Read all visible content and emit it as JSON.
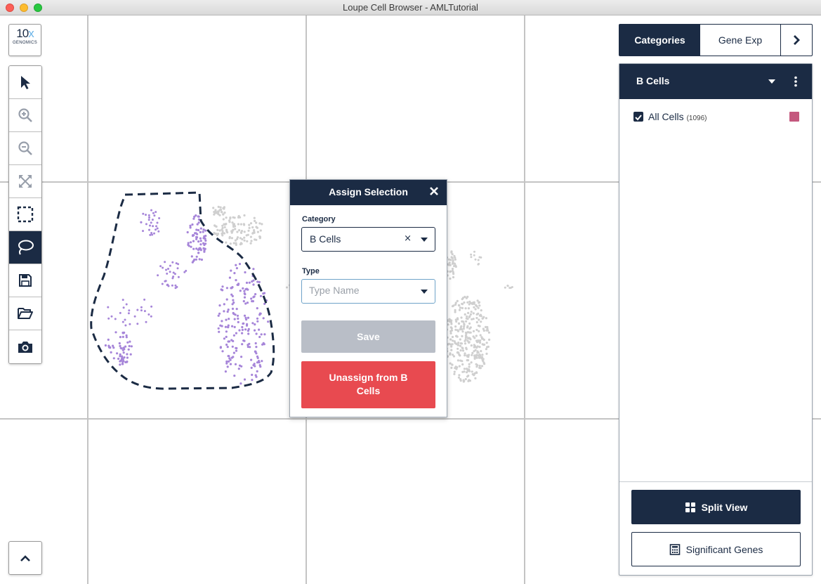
{
  "window": {
    "title": "Loupe Cell Browser - AMLTutorial"
  },
  "logo": {
    "main": "10",
    "x": "x",
    "sub": "GENOMICS"
  },
  "toolbar": {
    "tools": [
      {
        "icon": "pointer-icon",
        "active": false
      },
      {
        "icon": "zoom-in-icon",
        "active": false
      },
      {
        "icon": "zoom-out-icon",
        "active": false
      },
      {
        "icon": "fit-to-view-icon",
        "active": false
      },
      {
        "icon": "rectangle-select-icon",
        "active": false
      },
      {
        "icon": "lasso-select-icon",
        "active": true
      },
      {
        "icon": "save-icon",
        "active": false
      },
      {
        "icon": "open-folder-icon",
        "active": false
      },
      {
        "icon": "camera-icon",
        "active": false
      }
    ],
    "scroll_icon": "chevron-up-icon"
  },
  "dialog": {
    "title": "Assign Selection",
    "close_icon": "close-icon",
    "category_label": "Category",
    "category_value": "B Cells",
    "clear_icon": "×",
    "type_label": "Type",
    "type_placeholder": "Type Name",
    "save_label": "Save",
    "unassign_line1": "Unassign from B",
    "unassign_line2": "Cells"
  },
  "tabs": {
    "categories": "Categories",
    "gene_exp": "Gene Exp",
    "next_icon": "chevron-right-icon"
  },
  "panel": {
    "title": "B Cells",
    "rows": [
      {
        "label": "All Cells",
        "count": "(1096)",
        "checked": true,
        "color": "#c4587e"
      }
    ],
    "split_view": "Split View",
    "significant_genes": "Significant Genes"
  },
  "colors": {
    "navy": "#1b2b44",
    "selected_cells": "#a685d9",
    "unselected_cells": "#cfcfcf",
    "unassign_red": "#e84a50",
    "save_disabled": "#b9bec7"
  }
}
